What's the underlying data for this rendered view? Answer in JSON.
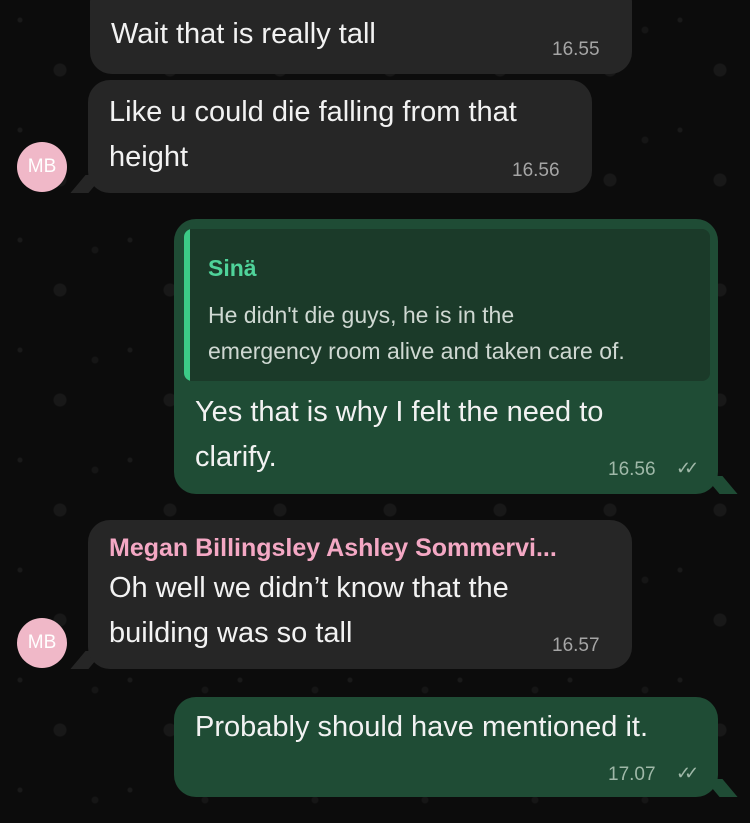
{
  "messages": [
    {
      "type": "incoming",
      "lines": [
        "Wait that is really tall"
      ],
      "time": "16.55"
    },
    {
      "type": "incoming",
      "avatar": "MB",
      "lines": [
        "Like u could die falling from that",
        "height"
      ],
      "time": "16.56"
    },
    {
      "type": "outgoing",
      "quote": {
        "sender": "Sinä",
        "lines": [
          "He didn't die guys, he is in the",
          "emergency room alive and taken care of."
        ]
      },
      "lines": [
        "Yes that is why I felt the need to",
        "clarify."
      ],
      "time": "16.56",
      "status_icon": "double-check-icon"
    },
    {
      "type": "incoming",
      "avatar": "MB",
      "sender": "Megan Billingsley Ashley Sommervi...",
      "lines": [
        "Oh well we didn’t know that the",
        "building was so tall"
      ],
      "time": "16.57"
    },
    {
      "type": "outgoing",
      "lines": [
        "Probably should have mentioned it."
      ],
      "time": "17.07",
      "status_icon": "double-check-icon"
    }
  ],
  "colors": {
    "incoming_bubble": "#262626",
    "outgoing_bubble": "#1f4c35",
    "quote_accent": "#3ccb87",
    "sender_name": "#f4a8c4",
    "avatar": "#f0b8c8"
  }
}
